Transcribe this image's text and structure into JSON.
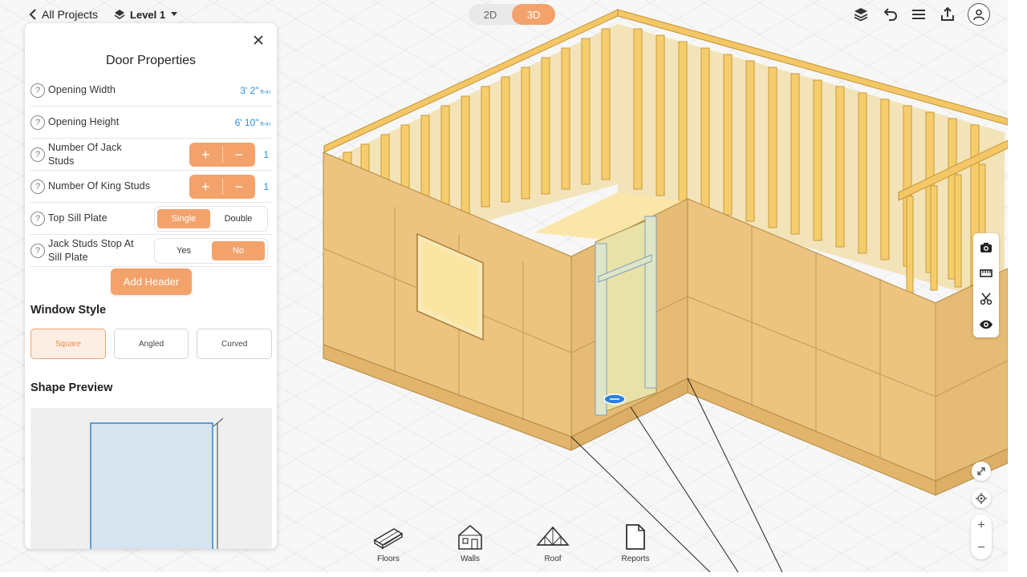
{
  "header": {
    "back_label": "All Projects",
    "level_label": "Level 1",
    "view_modes": [
      "2D",
      "3D"
    ],
    "active_view": "3D"
  },
  "panel": {
    "title": "Door Properties",
    "properties": [
      {
        "label": "Opening Width",
        "value": "3' 2\"",
        "unit": "ft-in"
      },
      {
        "label": "Opening Height",
        "value": "6' 10\"",
        "unit": "ft-in"
      },
      {
        "label": "Number Of Jack Studs",
        "count": "1",
        "plus": "+",
        "minus": "−"
      },
      {
        "label": "Number Of King Studs",
        "count": "1",
        "plus": "+",
        "minus": "−"
      },
      {
        "label": "Top Sill Plate",
        "options": [
          "Single",
          "Double"
        ],
        "selected": "Single"
      },
      {
        "label": "Jack Studs Stop At Sill Plate",
        "options": [
          "Yes",
          "No"
        ],
        "selected": "No"
      }
    ],
    "add_header_label": "Add Header",
    "window_style": {
      "title": "Window Style",
      "options": [
        "Square",
        "Angled",
        "Curved"
      ],
      "selected": "Square"
    },
    "shape_preview_title": "Shape Preview"
  },
  "bottom_nav": [
    "Floors",
    "Walls",
    "Roof",
    "Reports"
  ],
  "colors": {
    "accent": "#f4a26b",
    "value_blue": "#2d8fd5",
    "wood": "#ecc37f",
    "stud": "#f5cf76"
  }
}
